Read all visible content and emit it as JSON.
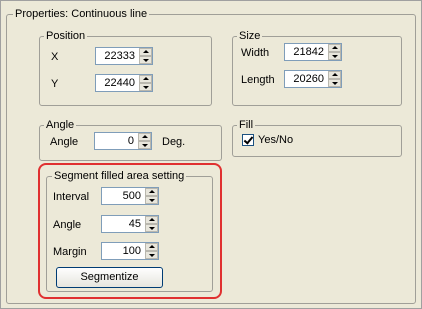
{
  "panel": {
    "title": "Properties: Continuous line"
  },
  "position": {
    "title": "Position",
    "x": {
      "label": "X",
      "value": "22333"
    },
    "y": {
      "label": "Y",
      "value": "22440"
    }
  },
  "size": {
    "title": "Size",
    "width": {
      "label": "Width",
      "value": "21842"
    },
    "length": {
      "label": "Length",
      "value": "20260"
    }
  },
  "angle": {
    "title": "Angle",
    "label": "Angle",
    "value": "0",
    "unit": "Deg."
  },
  "fill": {
    "title": "Fill",
    "checkbox_label": "Yes/No",
    "checked": true
  },
  "segment": {
    "title": "Segment filled area setting",
    "interval": {
      "label": "Interval",
      "value": "500"
    },
    "angle": {
      "label": "Angle",
      "value": "45"
    },
    "margin": {
      "label": "Margin",
      "value": "100"
    },
    "button_label": "Segmentize"
  },
  "colors": {
    "highlight": "#e03030",
    "panel_bg": "#ece9d8",
    "input_border": "#7f9db9"
  }
}
